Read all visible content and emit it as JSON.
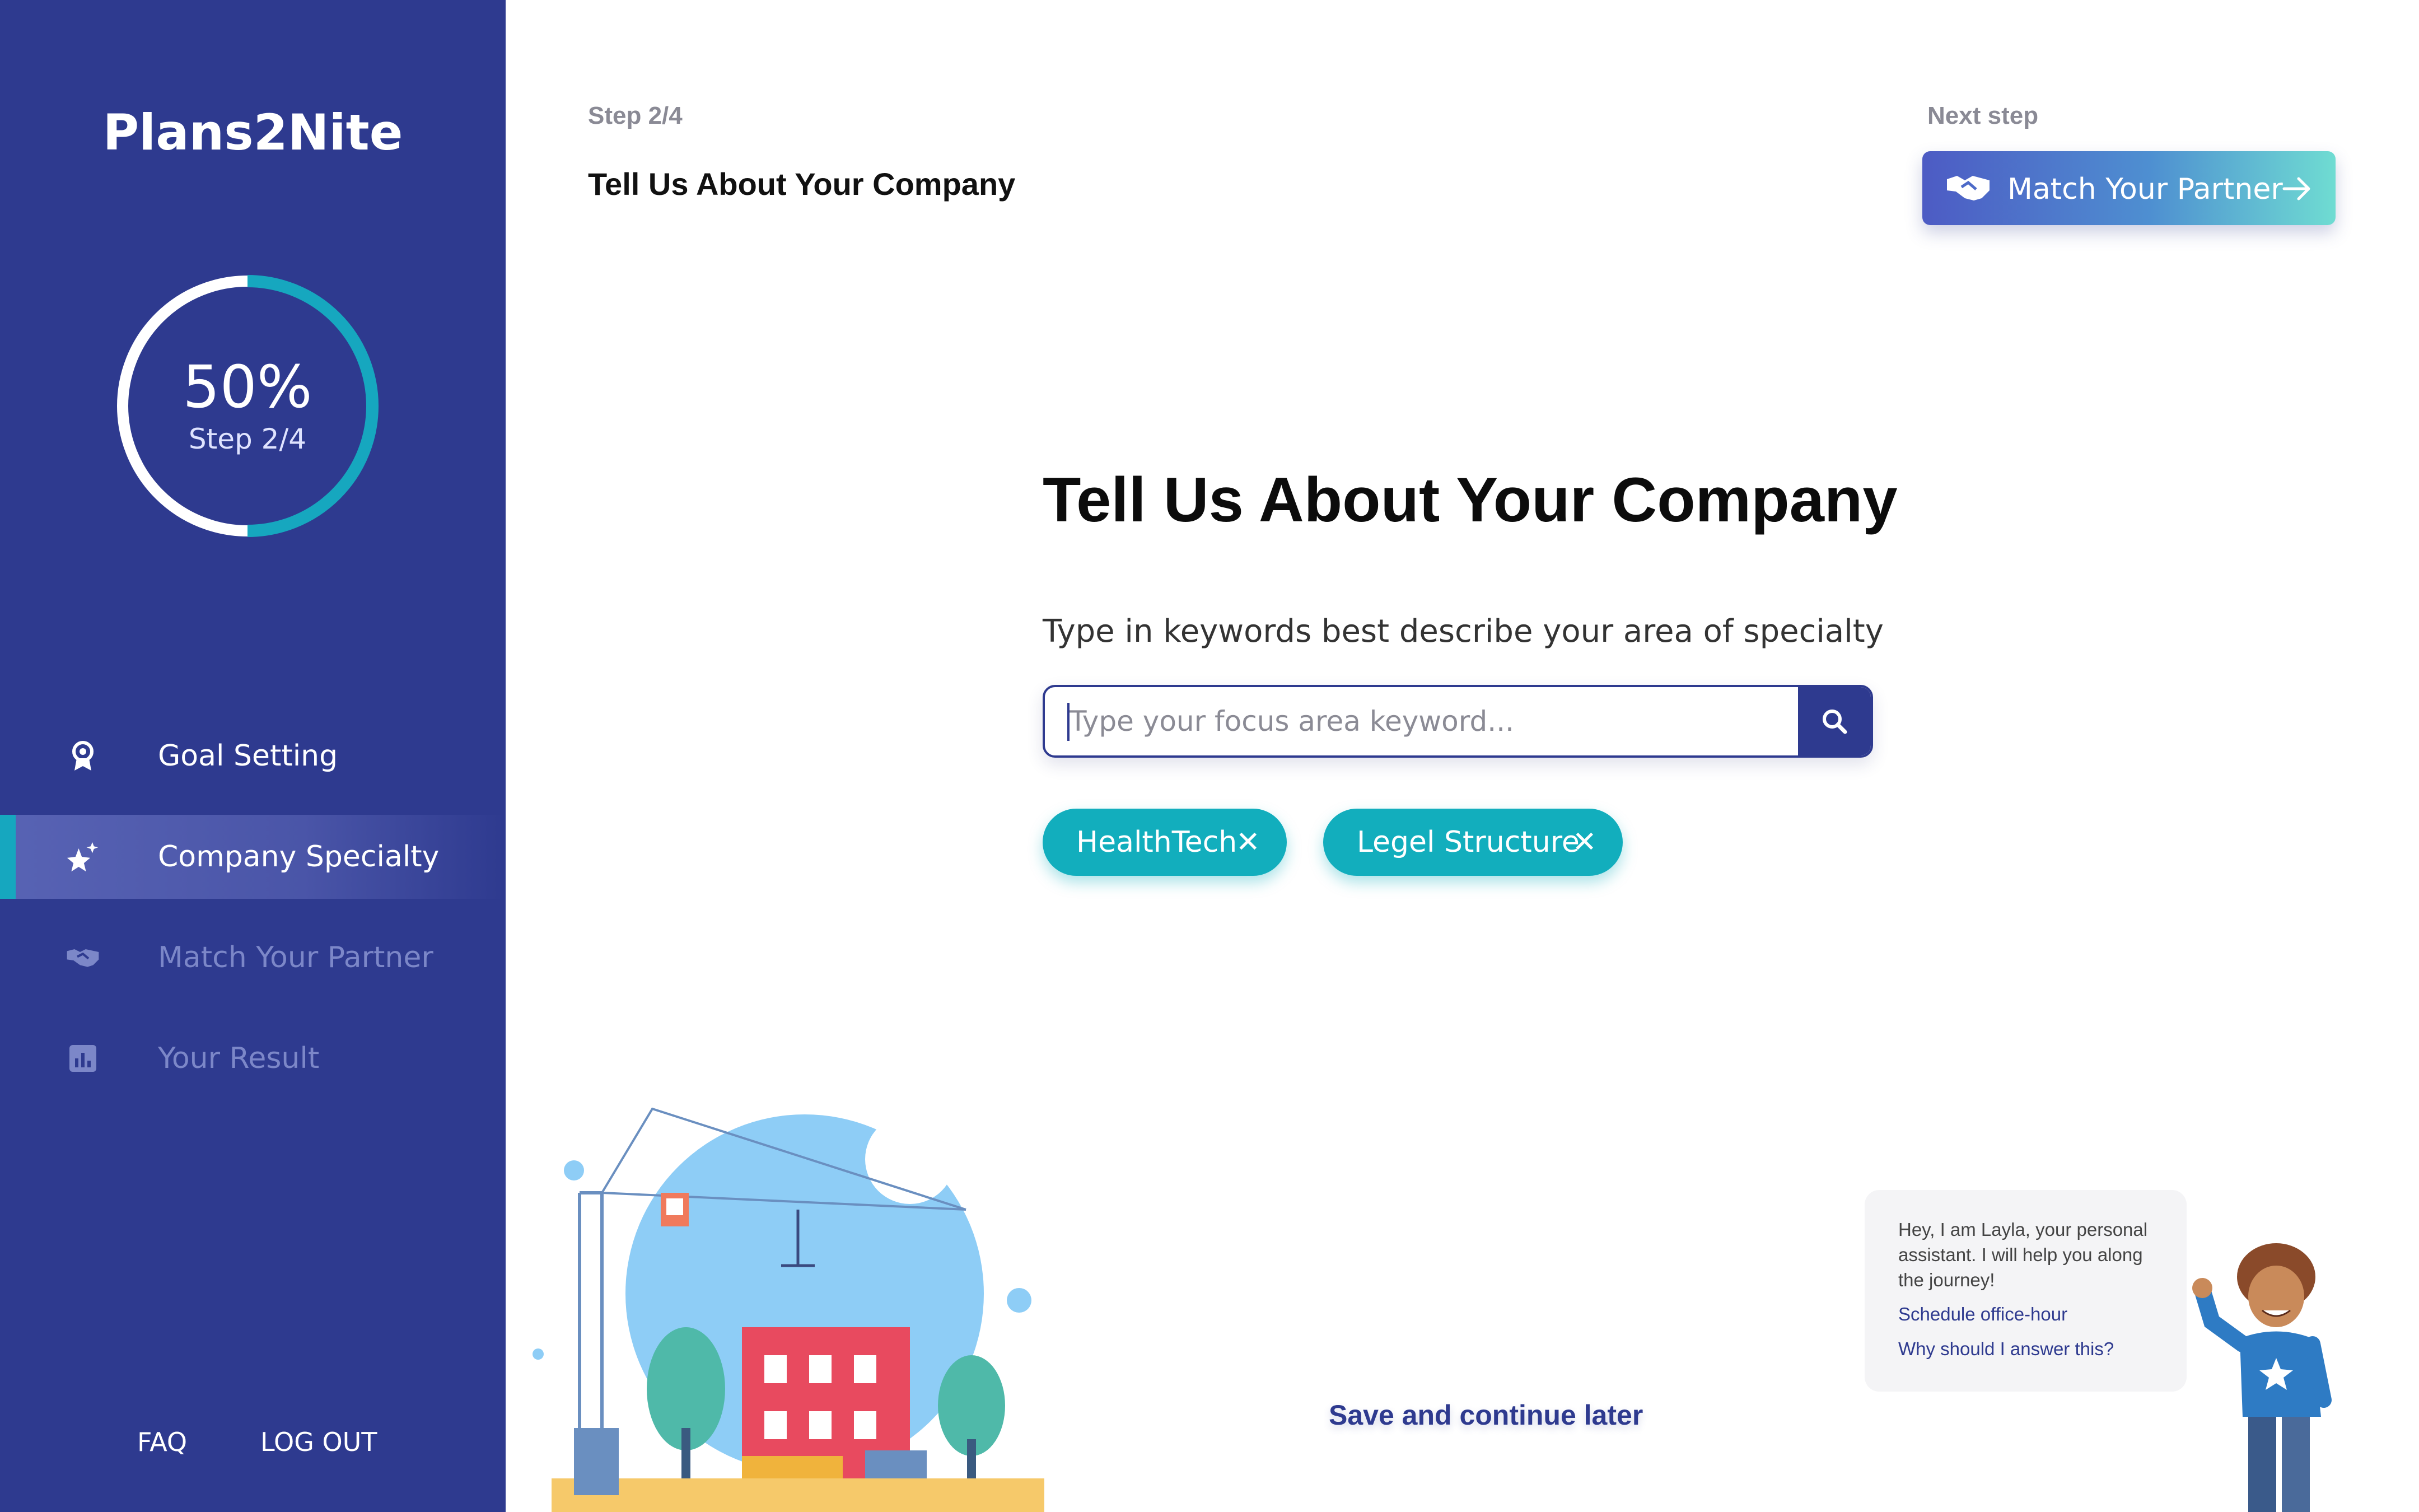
{
  "app": {
    "brand": "Plans2Nite"
  },
  "sidebar": {
    "progress": {
      "percent_label": "50%",
      "step_label": "Step 2/4",
      "fraction": 0.5
    },
    "items": [
      {
        "label": "Goal Setting",
        "icon": "award-icon",
        "state": "done"
      },
      {
        "label": "Company Specialty",
        "icon": "sparkle-star-icon",
        "state": "active"
      },
      {
        "label": "Match Your Partner",
        "icon": "handshake-icon",
        "state": "upcoming"
      },
      {
        "label": "Your Result",
        "icon": "bar-chart-icon",
        "state": "upcoming"
      }
    ],
    "footer": {
      "faq": "FAQ",
      "logout": "LOG OUT"
    }
  },
  "header": {
    "step": "Step 2/4",
    "title": "Tell Us About Your Company",
    "next_label": "Next step",
    "next_button": "Match Your Partner"
  },
  "main": {
    "title": "Tell Us About Your Company",
    "subtitle": "Type in keywords best describe your area of specialty",
    "search": {
      "placeholder": "Type your focus area keyword...",
      "value": ""
    },
    "chips": [
      {
        "label": "HealthTech"
      },
      {
        "label": "Legel Structure"
      }
    ],
    "save_later": "Save and continue later"
  },
  "assistant": {
    "message": "Hey, I am Layla, your personal assistant. I will help you along the journey!",
    "link_schedule": "Schedule office-hour",
    "link_why": "Why should I answer this?"
  },
  "colors": {
    "sidebar": "#2e3a8f",
    "accent": "#12aebd",
    "primary": "#2e3a8f"
  }
}
